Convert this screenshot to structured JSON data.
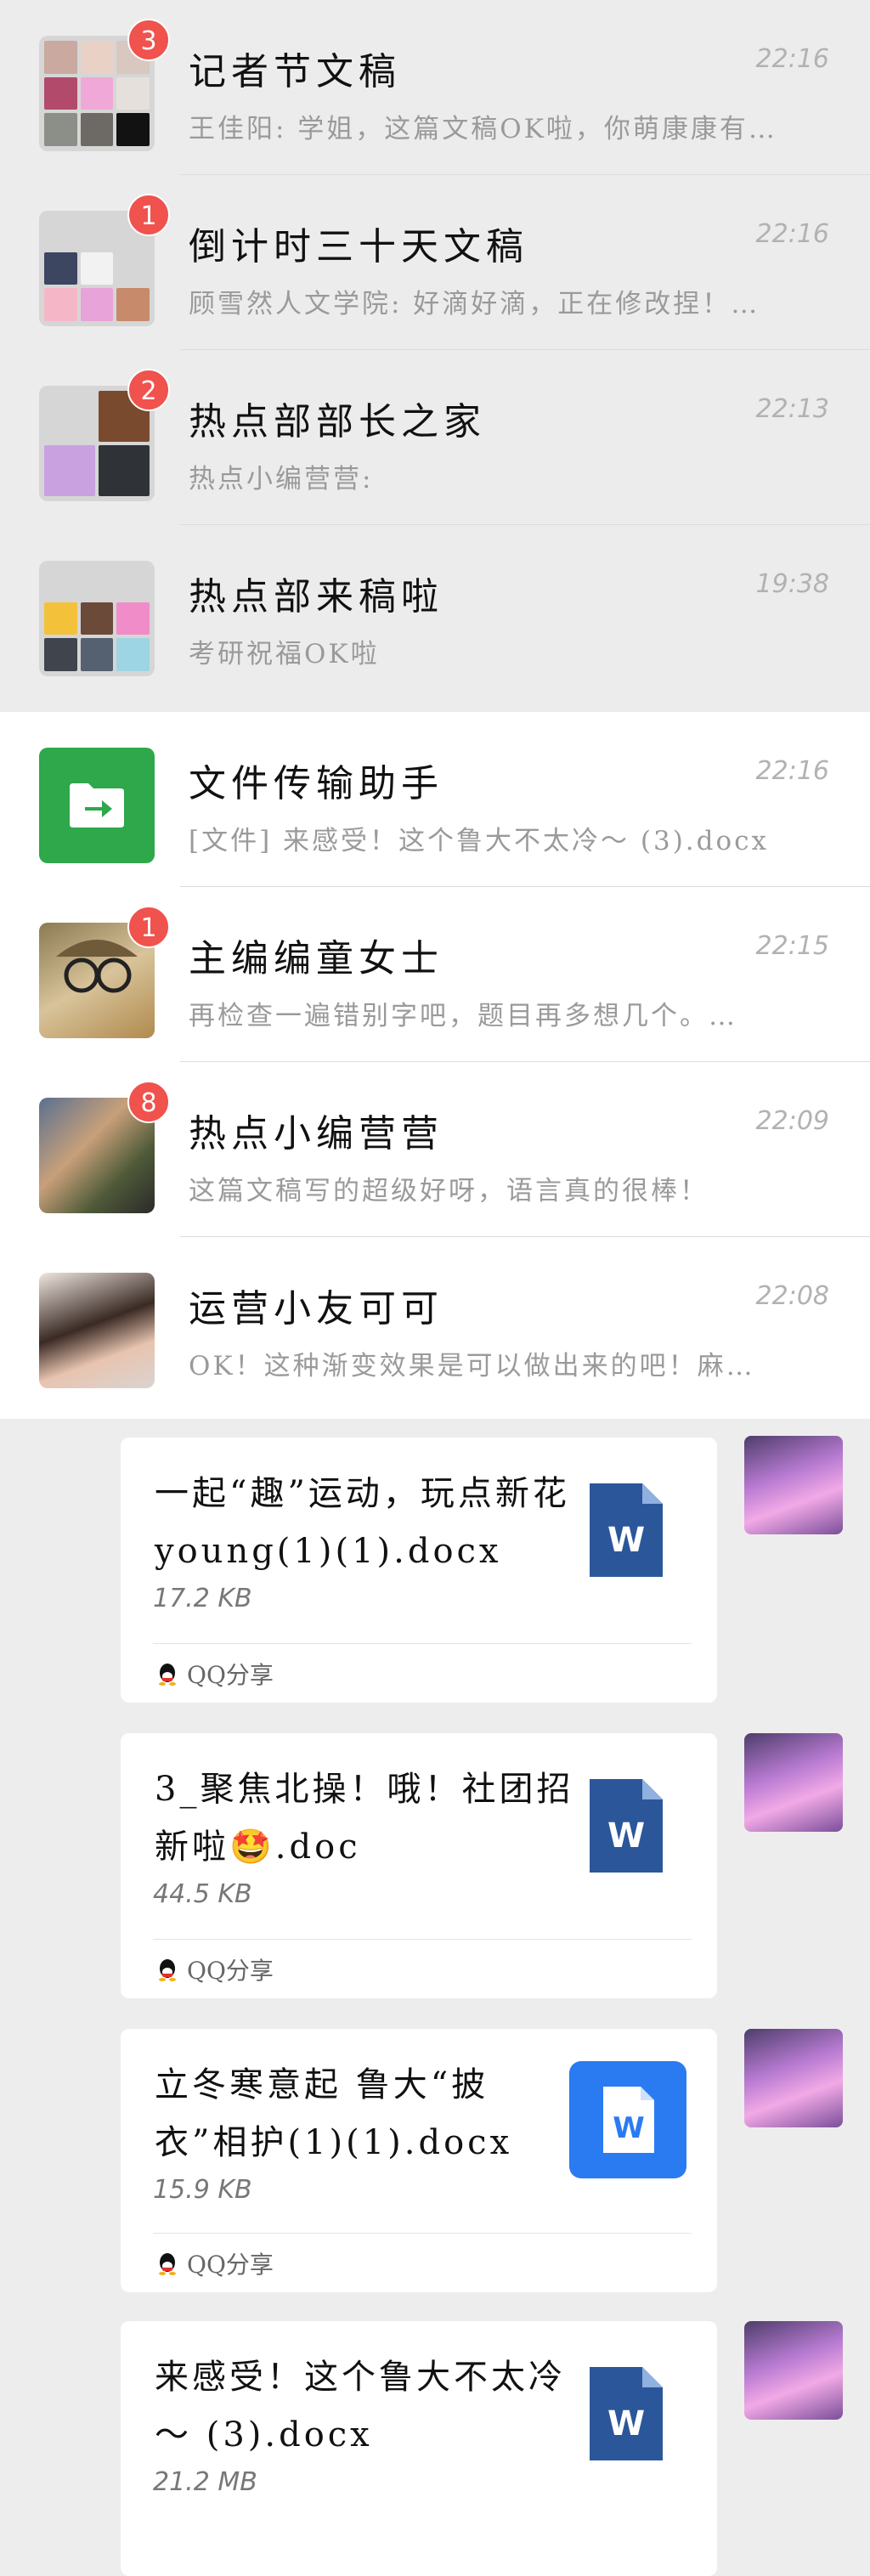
{
  "chats": [
    {
      "title": "记者节文稿",
      "time": "22:16",
      "preview": "王佳阳: 学姐，这篇文稿OK啦，你萌康康有…",
      "badge": "3",
      "style": "pinned",
      "avatar": "group"
    },
    {
      "title": "倒计时三十天文稿",
      "time": "22:16",
      "preview": "顾雪然人文学院: 好滴好滴，正在修改捏！…",
      "badge": "1",
      "style": "pinned",
      "avatar": "group"
    },
    {
      "title": "热点部部长之家",
      "time": "22:13",
      "preview": "热点小编营营:",
      "badge": "2",
      "style": "pinned",
      "avatar": "group"
    },
    {
      "title": "热点部来稿啦",
      "time": "19:38",
      "preview": "考研祝福OK啦",
      "badge": "",
      "style": "pinned",
      "avatar": "group"
    },
    {
      "title": "文件传输助手",
      "time": "22:16",
      "preview": "[文件] 来感受！这个鲁大不太冷～ (3).docx",
      "badge": "",
      "style": "normal",
      "avatar": "file-transfer"
    },
    {
      "title": "主编编童女士",
      "time": "22:15",
      "preview": "再检查一遍错别字吧，题目再多想几个。…",
      "badge": "1",
      "style": "normal",
      "avatar": "person"
    },
    {
      "title": "热点小编营营",
      "time": "22:09",
      "preview": "这篇文稿写的超级好呀，语言真的很棒！",
      "badge": "8",
      "style": "normal",
      "avatar": "person"
    },
    {
      "title": "运营小友可可",
      "time": "22:08",
      "preview": "OK！这种渐变效果是可以做出来的吧！麻…",
      "badge": "",
      "style": "normal",
      "avatar": "person"
    }
  ],
  "messages": [
    {
      "title": "一起“趣”运动，玩点新花young(1)(1).docx",
      "size": "17.2 KB",
      "source": "QQ分享",
      "icon": "word-icon"
    },
    {
      "title": "3_聚焦北操！哦！社团招新啦🤩.doc",
      "size": "44.5 KB",
      "source": "QQ分享",
      "icon": "word-icon"
    },
    {
      "title": "立冬寒意起 鲁大“披衣”相护(1)(1).docx",
      "size": "15.9 KB",
      "source": "QQ分享",
      "icon": "word-square-icon"
    },
    {
      "title": "来感受！这个鲁大不太冷～ (3).docx",
      "size": "21.2 MB",
      "source": "",
      "icon": "word-icon"
    }
  ],
  "colors": {
    "badge": "#f0524d",
    "file_transfer": "#2ea84a",
    "word": "#2b579a",
    "word_square": "#2a7bf2"
  }
}
